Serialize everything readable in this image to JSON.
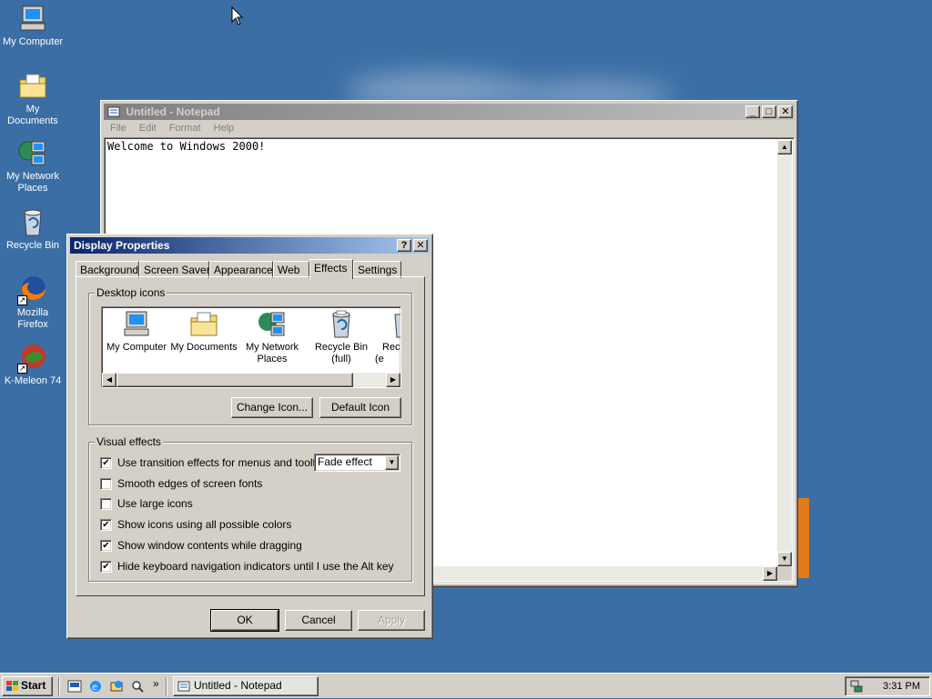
{
  "colors": {
    "desktop": "#3a6ea5",
    "titlebar_active": "#0a246a",
    "titlebar_inactive": "#808080",
    "face": "#d4d0c8"
  },
  "desktop_icons": [
    {
      "label": "My Computer",
      "icon": "computer-icon"
    },
    {
      "label": "My Documents",
      "icon": "folder-icon"
    },
    {
      "label": "My Network Places",
      "icon": "network-icon"
    },
    {
      "label": "Recycle Bin",
      "icon": "recycle-bin-icon"
    },
    {
      "label": "Mozilla Firefox",
      "icon": "firefox-icon"
    },
    {
      "label": "K-Meleon 74",
      "icon": "kmeleon-icon"
    }
  ],
  "notepad": {
    "title": "Untitled - Notepad",
    "menu": [
      "File",
      "Edit",
      "Format",
      "Help"
    ],
    "content": "Welcome to Windows 2000!"
  },
  "dialog": {
    "title": "Display Properties",
    "help_btn": "?",
    "close_btn": "✕",
    "tabs": [
      "Background",
      "Screen Saver",
      "Appearance",
      "Web",
      "Effects",
      "Settings"
    ],
    "active_tab": "Effects",
    "desktop_icons_group": "Desktop icons",
    "list_icons": [
      {
        "label": "My Computer"
      },
      {
        "label": "My Documents"
      },
      {
        "label": "My Network Places"
      },
      {
        "label": "Recycle Bin (full)"
      },
      {
        "label": "Rec (e"
      }
    ],
    "change_icon_btn": "Change Icon...",
    "default_icon_btn": "Default Icon",
    "visual_effects_group": "Visual effects",
    "effects": [
      {
        "label": "Use transition effects for menus and tooltips",
        "checked": true
      },
      {
        "label": "Smooth edges of screen fonts",
        "checked": false
      },
      {
        "label": "Use large icons",
        "checked": false
      },
      {
        "label": "Show icons using all possible colors",
        "checked": true
      },
      {
        "label": "Show window contents while dragging",
        "checked": true
      },
      {
        "label": "Hide keyboard navigation indicators until I use the Alt key",
        "checked": true
      }
    ],
    "transition_select": "Fade effect",
    "ok_btn": "OK",
    "cancel_btn": "Cancel",
    "apply_btn": "Apply"
  },
  "taskbar": {
    "start_label": "Start",
    "quicklaunch_more": "»",
    "task_label": "Untitled - Notepad",
    "clock": "3:31 PM"
  }
}
